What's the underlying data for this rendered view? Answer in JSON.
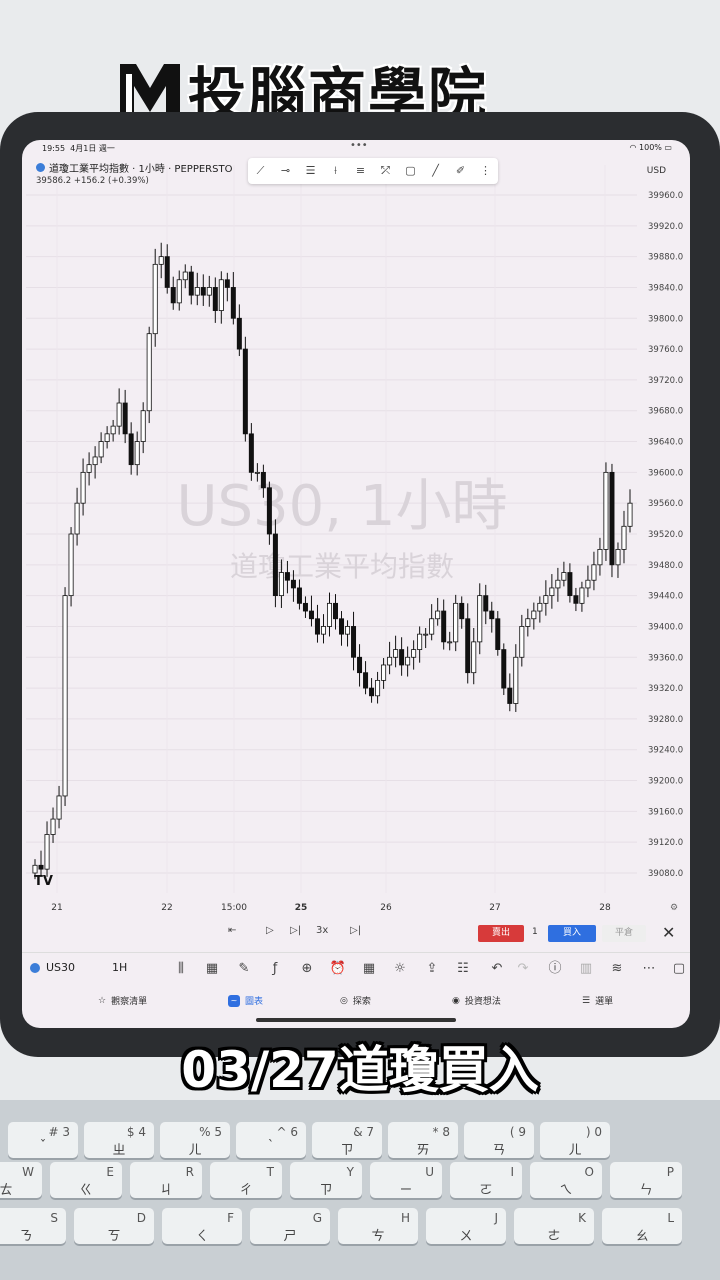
{
  "brand": {
    "name": "投腦商學院",
    "logo": "M-logo"
  },
  "status": {
    "time": "19:55",
    "date": "4月1日 週一",
    "battery": "100%"
  },
  "symbol": {
    "title": "道瓊工業平均指數 · 1小時 · PEPPERSTO",
    "price": "39586.2 +156.2 (+0.39%)",
    "currency": "USD"
  },
  "watermark": {
    "main": "US30, 1小時",
    "sub": "道瓊工業平均指數"
  },
  "colors": {
    "up": "#ffffff",
    "down": "#111111",
    "sell": "#d73a3a",
    "buy": "#2f6fe0",
    "accent": "#2f6fe0"
  },
  "chart_data": {
    "type": "candlestick",
    "x_labels": [
      "21",
      "22",
      "15:00",
      "25",
      "26",
      "27",
      "28"
    ],
    "y_ticks": [
      "39960.0",
      "39920.0",
      "39880.0",
      "39840.0",
      "39800.0",
      "39760.0",
      "39720.0",
      "39680.0",
      "39640.0",
      "39600.0",
      "39560.0",
      "39520.0",
      "39480.0",
      "39440.0",
      "39400.0",
      "39360.0",
      "39320.0",
      "39280.0",
      "39240.0",
      "39200.0",
      "39160.0",
      "39120.0",
      "39080.0"
    ],
    "ylim": [
      39080,
      39960
    ],
    "last_price": 39586.2,
    "close_path": [
      39090,
      39085,
      39130,
      39150,
      39180,
      39440,
      39520,
      39560,
      39600,
      39610,
      39620,
      39640,
      39650,
      39660,
      39690,
      39650,
      39610,
      39640,
      39680,
      39780,
      39870,
      39880,
      39840,
      39820,
      39850,
      39860,
      39830,
      39840,
      39830,
      39840,
      39810,
      39850,
      39840,
      39800,
      39760,
      39650,
      39600,
      39600,
      39580,
      39520,
      39440,
      39470,
      39460,
      39450,
      39430,
      39420,
      39410,
      39390,
      39400,
      39430,
      39410,
      39390,
      39400,
      39360,
      39340,
      39320,
      39310,
      39330,
      39350,
      39360,
      39370,
      39350,
      39360,
      39370,
      39390,
      39390,
      39410,
      39420,
      39380,
      39380,
      39430,
      39410,
      39340,
      39380,
      39440,
      39420,
      39410,
      39370,
      39320,
      39300,
      39360,
      39400,
      39410,
      39420,
      39430,
      39440,
      39450,
      39460,
      39470,
      39440,
      39430,
      39450,
      39460,
      39480,
      39500,
      39600,
      39480,
      39500,
      39530,
      39560
    ]
  },
  "replay": {
    "speed": "3x",
    "sell": "賣出",
    "qty": "1",
    "buy": "買入",
    "flat": "平倉"
  },
  "toolbar": {
    "symbol": "US30",
    "timeframe": "1H"
  },
  "nav": {
    "watchlist": "觀察清單",
    "chart": "圖表",
    "explore": "探索",
    "ideas": "投資想法",
    "menu": "選單"
  },
  "caption": "03/27道瓊買入",
  "keyboard": {
    "row1": [
      [
        "#",
        "3"
      ],
      [
        "$",
        "4"
      ],
      [
        "%",
        "5"
      ],
      [
        "^",
        "6"
      ],
      [
        "&",
        "7"
      ],
      [
        "*",
        "8"
      ],
      [
        "(",
        "9"
      ],
      [
        ")",
        "0"
      ]
    ],
    "row1_b": [
      "ˇ",
      "ㄓ",
      "ㄦ",
      "ˋ",
      "ㄗ",
      "ㄞ",
      "ㄢ",
      "ㄦ"
    ],
    "row2": [
      "W",
      "E",
      "R",
      "T",
      "Y",
      "U",
      "I",
      "O",
      "P"
    ],
    "row2_b": [
      "ㄊ",
      "ㄍ",
      "ㄐ",
      "ㄔ",
      "ㄗ",
      "ㄧ",
      "ㄛ",
      "ㄟ",
      "ㄣ"
    ],
    "row3": [
      "S",
      "D",
      "F",
      "G",
      "H",
      "J",
      "K",
      "L"
    ],
    "row3_b": [
      "ㄋ",
      "ㄎ",
      "ㄑ",
      "ㄕ",
      "ㄘ",
      "ㄨ",
      "ㄜ",
      "ㄠ"
    ]
  }
}
